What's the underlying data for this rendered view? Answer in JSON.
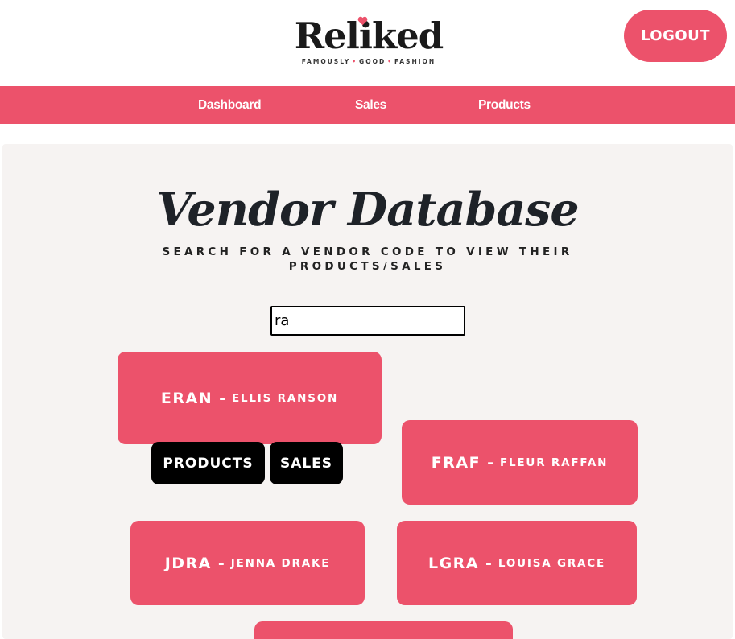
{
  "header": {
    "logo_text": "Reliked",
    "logo_tagline": [
      "FAMOUSLY",
      "GOOD",
      "FASHION"
    ],
    "logout_label": "LOGOUT",
    "accent_color": "#ec526b"
  },
  "nav": {
    "items": [
      {
        "label": "Dashboard"
      },
      {
        "label": "Sales"
      },
      {
        "label": "Products"
      }
    ]
  },
  "main": {
    "title": "Vendor Database",
    "subtitle_line1": "SEARCH FOR A VENDOR CODE TO VIEW THEIR",
    "subtitle_line2": "PRODUCTS/SALES",
    "search": {
      "value": "ra",
      "placeholder": ""
    },
    "vendors": [
      {
        "code": "ERAN",
        "name": "Ellis Ranson",
        "expanded": true
      },
      {
        "code": "FRAF",
        "name": "fleur raffan"
      },
      {
        "code": "JDRA",
        "name": "Jenna Drake"
      },
      {
        "code": "LGRA",
        "name": "Louisa Grace"
      },
      {
        "code": "",
        "name": ""
      }
    ],
    "vendor_actions": {
      "products_label": "PRODUCTS",
      "sales_label": "SALES"
    }
  }
}
